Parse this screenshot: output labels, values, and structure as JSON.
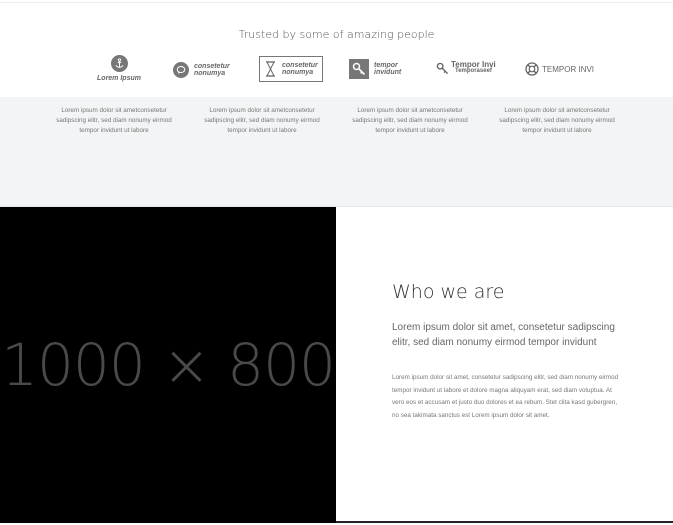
{
  "trusted": {
    "heading": "Trusted by some of amazing people"
  },
  "logos": [
    {
      "icon": "anchor-icon",
      "line1": "Lorem Ipsum",
      "line2": ""
    },
    {
      "icon": "chat-bubble-icon",
      "line1": "consetetur",
      "line2": "nonumya"
    },
    {
      "icon": "hourglass-icon",
      "line1": "consetetur",
      "line2": "nonumya"
    },
    {
      "icon": "key-icon",
      "line1": "tempor",
      "line2": "invidunt"
    },
    {
      "icon": "key-outline-icon",
      "line1": "Tempor Invi",
      "line2": "Temporaseef"
    },
    {
      "icon": "life-ring-icon",
      "line1": "TEMPOR INVI",
      "line2": ""
    }
  ],
  "testimonials": [
    "Lorem ipsum dolor sit ametconsetetur sadipscing elitr, sed diam nonumy eirmod tempor invidunt ut labore",
    "Lorem ipsum dolor sit ametconsetetur sadipscing elitr, sed diam nonumy eirmod tempor invidunt ut labore",
    "Lorem ipsum dolor sit ametconsetetur sadipscing elitr, sed diam nonumy eirmod tempor invidunt ut labore",
    "Lorem ipsum dolor sit ametconsetetur sadipscing elitr, sed diam nonumy eirmod tempor invidunt ut labore"
  ],
  "placeholder": {
    "label": "1000 × 800"
  },
  "about": {
    "title": "Who we are",
    "lead": "Lorem ipsum dolor sit amet, consetetur sadipscing elitr, sed diam nonumy eirmod tempor invidunt",
    "body": "Lorem ipsum dolor sit amet, consetetur sadipscing elitr, sed diam nonumy eirmod tempor invidunt ut labore et dolore magna aliquyam erat, sed diam voluptua. At vero eos et accusam et justo duo dolores et ea rebum. Stet clita kasd gubergren, no sea takimata sanctus est Lorem ipsum dolor sit amet."
  },
  "colors": {
    "logo_grey": "#777777",
    "band_bg": "#f3f4f5",
    "image_bg": "#000000"
  }
}
